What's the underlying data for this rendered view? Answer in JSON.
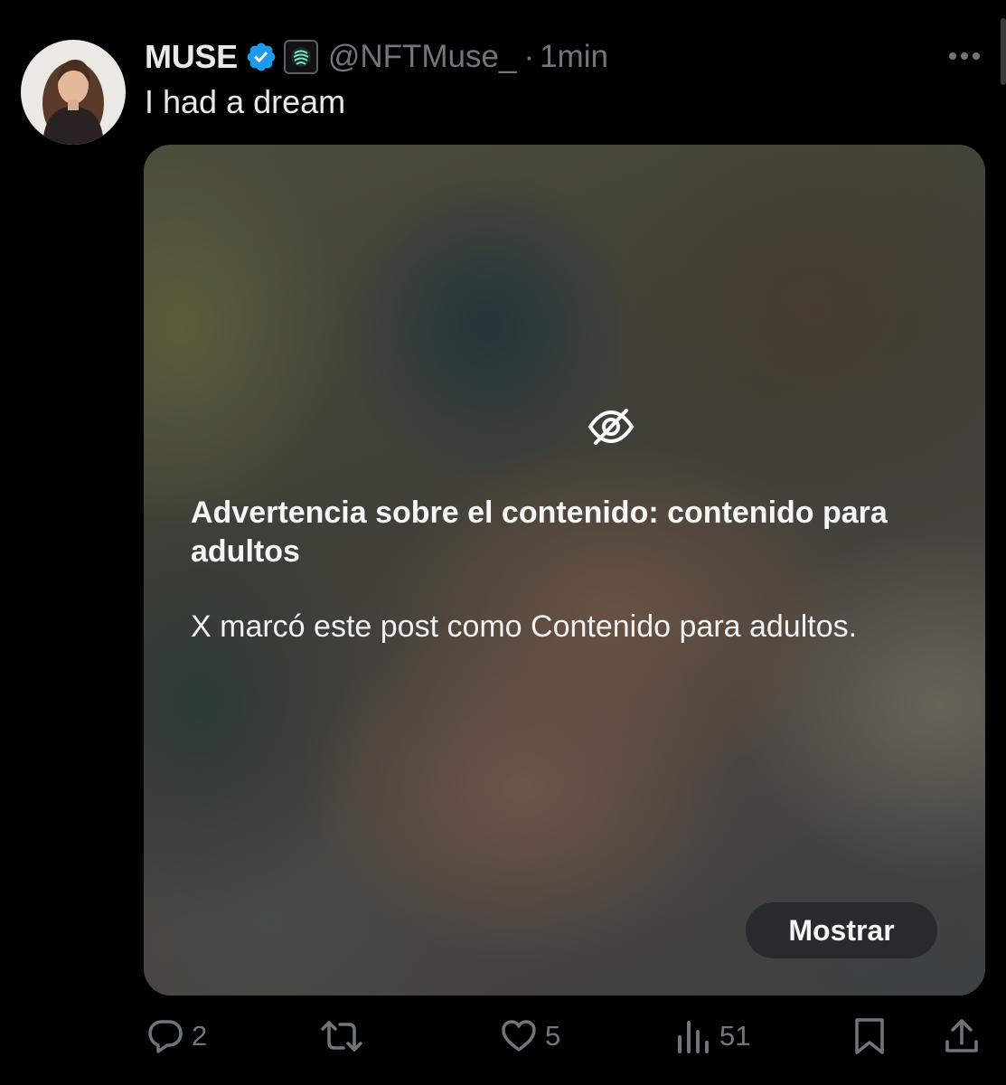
{
  "post": {
    "display_name": "MUSE",
    "handle": "@NFTMuse_",
    "separator": "·",
    "timestamp": "1min",
    "text": "I had a dream",
    "verified_color": "#1d9bf0",
    "avatar_icon": "profile-photo",
    "affiliate_icon": "nft-muse-badge-icon",
    "more_icon": "more-horizontal-icon"
  },
  "media": {
    "warning_icon": "eye-slash-icon",
    "warning_title": "Advertencia sobre el contenido: contenido para adultos",
    "warning_body": "X marcó este post como Contenido para adultos.",
    "show_button_label": "Mostrar"
  },
  "actions": {
    "reply_count": "2",
    "repost_count": "",
    "like_count": "5",
    "views_count": "51",
    "icons": [
      "reply-icon",
      "repost-icon",
      "like-icon",
      "views-icon",
      "bookmark-icon",
      "share-icon"
    ]
  },
  "colors": {
    "background": "#000000",
    "primary_text": "#e7e9ea",
    "secondary_text": "#71767b",
    "verified": "#1d9bf0"
  }
}
